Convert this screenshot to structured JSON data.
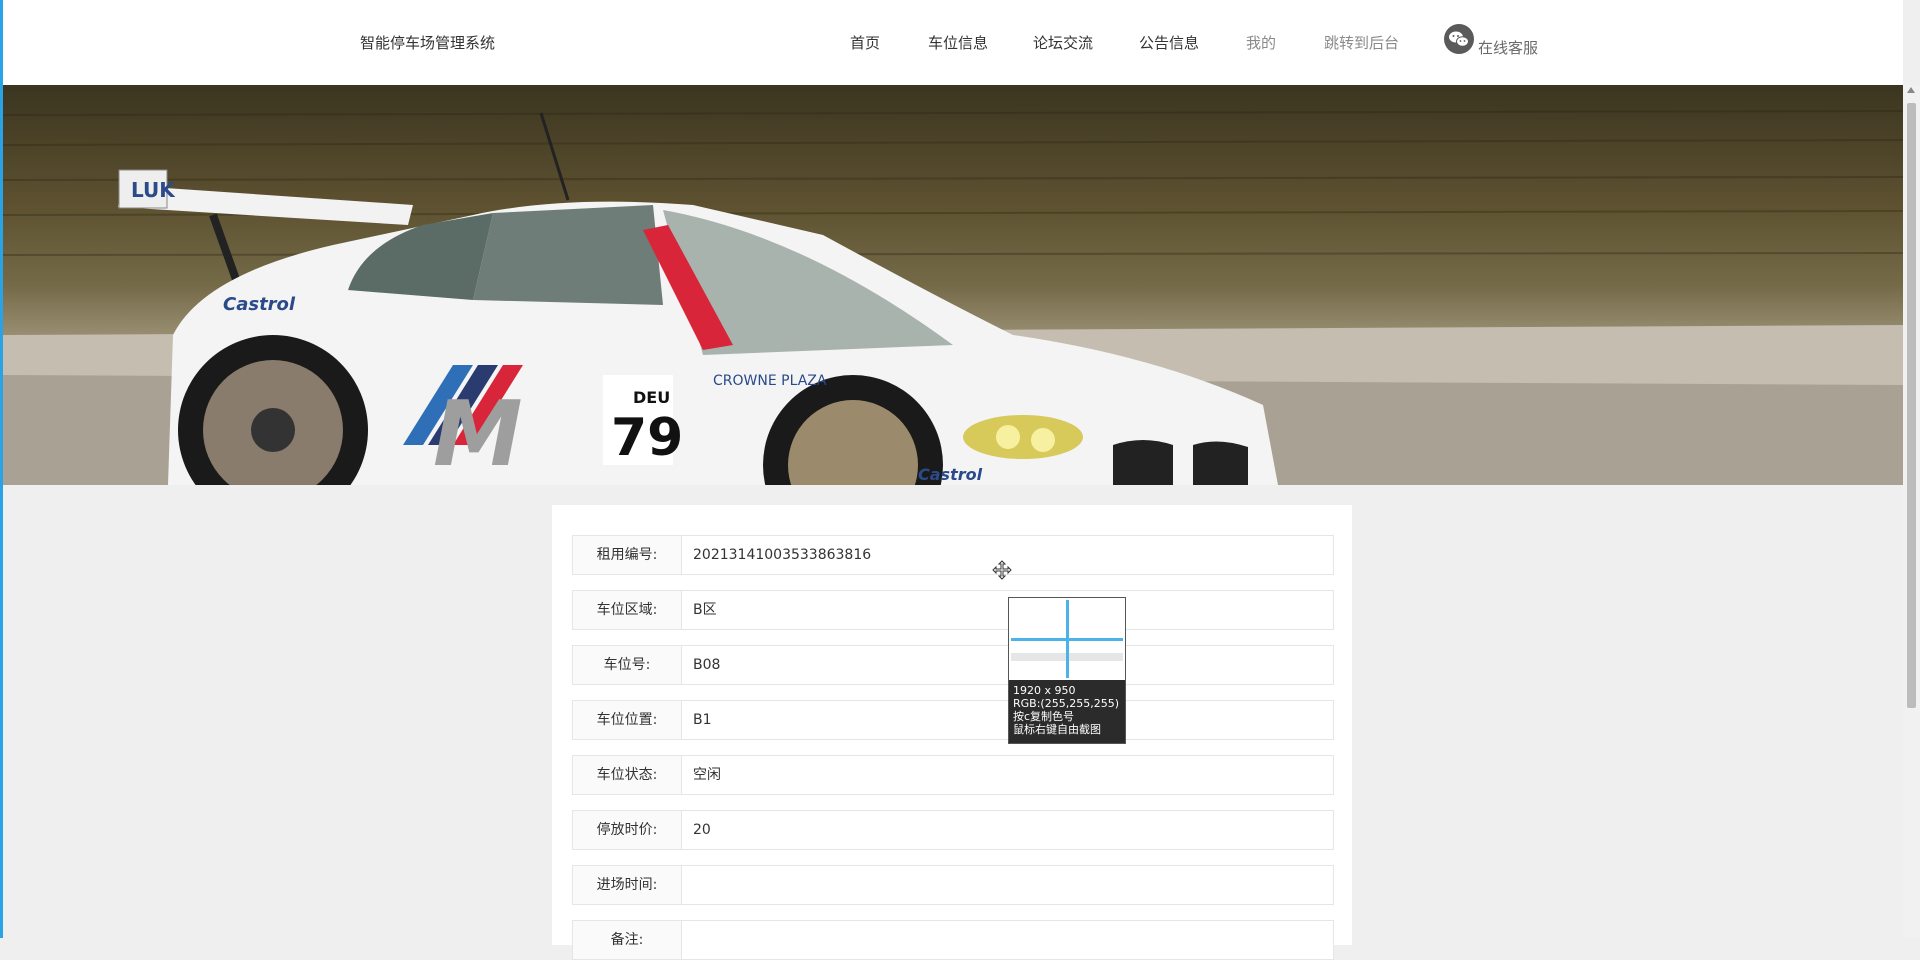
{
  "header": {
    "brand": "智能停车场管理系统",
    "nav": [
      {
        "label": "首页"
      },
      {
        "label": "车位信息"
      },
      {
        "label": "论坛交流"
      },
      {
        "label": "公告信息"
      },
      {
        "label": "我的"
      },
      {
        "label": "跳转到后台"
      }
    ],
    "support_label": "在线客服",
    "support_icon": "wechat-icon"
  },
  "form": {
    "rows": [
      {
        "label": "租用编号:",
        "value": "20213141003533863816"
      },
      {
        "label": "车位区域:",
        "value": "B区"
      },
      {
        "label": "车位号:",
        "value": "B08"
      },
      {
        "label": "车位位置:",
        "value": "B1"
      },
      {
        "label": "车位状态:",
        "value": "空闲"
      },
      {
        "label": "停放时价:",
        "value": "20"
      },
      {
        "label": "进场时间:",
        "value": ""
      },
      {
        "label": "备注:",
        "value": ""
      }
    ]
  },
  "color_picker": {
    "size": "1920 x 950",
    "rgb": "RGB:(255,255,255)",
    "copy_hint": "按c复制色号",
    "capture_hint": "鼠标右键自由截图",
    "crosshair_color": "#4bb3e8"
  },
  "colors": {
    "accent": "#29a3e6",
    "page_bg": "#efefef"
  }
}
